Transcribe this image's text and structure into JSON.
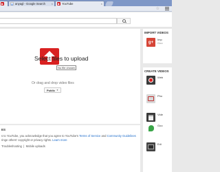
{
  "browser": {
    "tabs": [
      {
        "title": "",
        "icon": "youtube-favicon"
      },
      {
        "title": "anyagl - Google Search",
        "icon": "google-favicon"
      },
      {
        "title": "YouTube",
        "icon": "youtube-favicon"
      }
    ],
    "tab_close": "×"
  },
  "upload": {
    "title": "Select files to upload",
    "subtitle": "Or drag and drop video files",
    "privacy_value": "Public",
    "tooltip": "No file chosen"
  },
  "bottom": {
    "heading": "ES",
    "line1": "s to YouTube, you acknowledge that you agree to YouTube's",
    "tos_link": "Terms of Service",
    "and": "and",
    "guidelines_link": "Community Guidelines",
    "line2": "ringe others' copyright or privacy rights.",
    "learn_more": "Learn more",
    "troubleshooting": "Troubleshooting",
    "separator": "|",
    "mobile_uploads": "Mobile uploads"
  },
  "sidebar": {
    "import_heading": "IMPORT VIDEOS",
    "import_items": [
      {
        "label": "Imp",
        "sub": "Goo",
        "icon": "google-plus-icon"
      }
    ],
    "create_heading": "CREATE VIDEOS",
    "create_items": [
      {
        "label": "Web",
        "icon": "webcam-record-icon"
      },
      {
        "label": "Pho",
        "icon": "photo-slideshow-icon"
      },
      {
        "label": "Vide",
        "icon": "video-editor-icon"
      },
      {
        "label": "Goo",
        "icon": "hangouts-icon"
      },
      {
        "label": "Edi",
        "icon": "edit-icon"
      }
    ]
  },
  "colors": {
    "youtube_red": "#d92121",
    "link_blue": "#1b6ac9",
    "tab_bar": "#7e97c7"
  }
}
